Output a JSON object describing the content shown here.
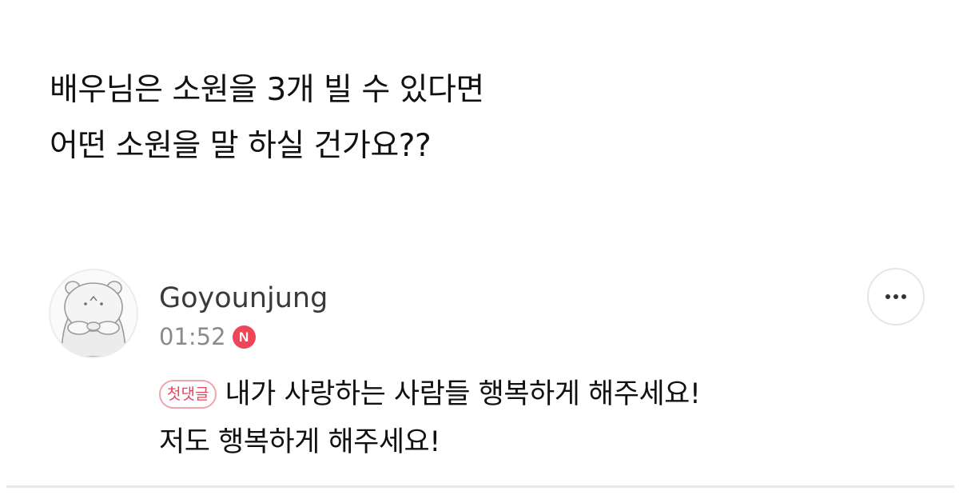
{
  "post": {
    "question_line1": "배우님은 소원을 3개 빌 수 있다면",
    "question_line2": "어떤 소원을 말 하실 건가요??"
  },
  "comment": {
    "username": "Goyounjung",
    "time": "01:52",
    "new_badge": "N",
    "first_comment_badge": "첫댓글",
    "text_line1": "내가 사랑하는 사람들 행복하게 해주세요!",
    "text_line2": "저도 행복하게 해주세요!",
    "more_icon": "ellipsis-icon",
    "avatar_icon": "hamster-avatar-icon"
  },
  "colors": {
    "badge_red": "#f04458",
    "badge_border": "#f2a3ad",
    "meta_gray": "#8a8a8a",
    "divider": "#e8e8e8"
  }
}
